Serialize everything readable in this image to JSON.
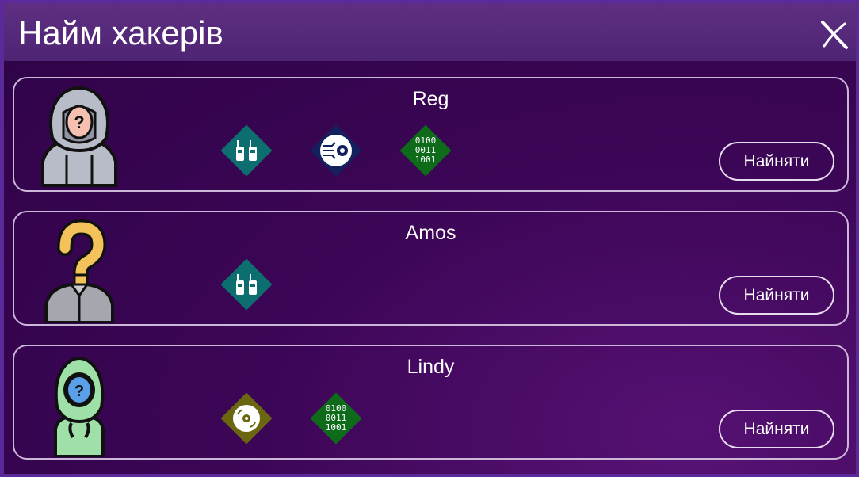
{
  "header": {
    "title": "Найм хакерів"
  },
  "colors": {
    "teal": "#0c6e6e",
    "navy": "#12205e",
    "green": "#0d6b1a",
    "olive": "#6b6610"
  },
  "hackers": [
    {
      "name": "Reg",
      "avatar": "hooded-gray-hacker",
      "hire_label": "Найняти",
      "skills": [
        {
          "icon": "walkie-talkie-icon",
          "color": "#0c6e6e"
        },
        {
          "icon": "cyber-eye-icon",
          "color": "#12205e"
        },
        {
          "icon": "binary-code-icon",
          "color": "#0d6b1a",
          "text": [
            "0100",
            "0011",
            "1001"
          ]
        }
      ]
    },
    {
      "name": "Amos",
      "avatar": "question-mark-person",
      "hire_label": "Найняти",
      "skills": [
        {
          "icon": "walkie-talkie-icon",
          "color": "#0c6e6e"
        }
      ]
    },
    {
      "name": "Lindy",
      "avatar": "hooded-green-hacker",
      "hire_label": "Найняти",
      "skills": [
        {
          "icon": "disc-icon",
          "color": "#6b6610"
        },
        {
          "icon": "binary-code-icon",
          "color": "#0d6b1a",
          "text": [
            "0100",
            "0011",
            "1001"
          ]
        }
      ]
    }
  ]
}
